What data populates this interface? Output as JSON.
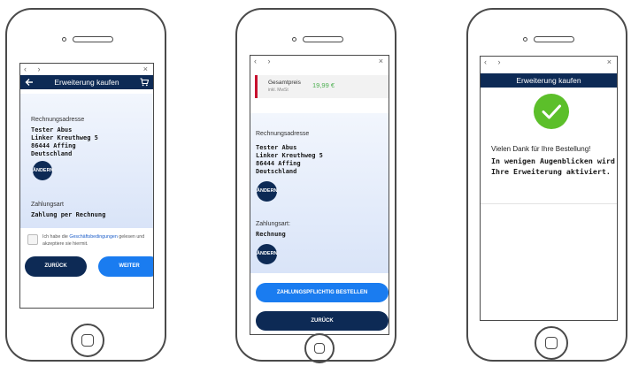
{
  "screen1": {
    "browser": {
      "nav": "‹ ›",
      "close": "×"
    },
    "header": {
      "back_icon": "arrow-left",
      "title": "Erweiterung kaufen",
      "cart_icon": "cart"
    },
    "billing": {
      "label": "Rechnungsadresse",
      "name": "Tester Abus",
      "street": "Linker Kreuthweg 5",
      "city": "86444 Affing",
      "country": "Deutschland",
      "change_button": "ÄNDERN"
    },
    "payment": {
      "label": "Zahlungsart",
      "value": "Zahlung per Rechnung"
    },
    "terms": {
      "checked": false,
      "text_before": "Ich habe die ",
      "link": "Geschäftsbedingungen",
      "text_after": " gelesen und akzeptiere sie hiermit."
    },
    "buttons": {
      "back": "ZURÜCK",
      "next": "WEITER"
    }
  },
  "screen2": {
    "browser": {
      "nav": "‹ ›",
      "close": "×"
    },
    "summary": {
      "label": "Gesamtpreis",
      "sublabel": "inkl. MwSt",
      "price": "19,99 €",
      "accent_color": "#c8102e",
      "price_color": "#4caf50"
    },
    "billing": {
      "label": "Rechnungsadresse",
      "name": "Tester Abus",
      "street": "Linker Kreuthweg 5",
      "city": "86444 Affing",
      "country": "Deutschland",
      "change_button": "ÄNDERN"
    },
    "payment": {
      "label": "Zahlungsart:",
      "value": "Rechnung",
      "change_button": "ÄNDERN"
    },
    "buttons": {
      "order": "ZAHLUNGSPFLICHTIG BESTELLEN",
      "back": "ZURÜCK"
    }
  },
  "screen3": {
    "browser": {
      "nav": "‹ ›",
      "close": "×"
    },
    "header": {
      "title": "Erweiterung kaufen"
    },
    "success_icon": "check-circle",
    "success_color": "#5cbf2a",
    "thanks": "Vielen Dank für Ihre Bestellung!",
    "message": "In wenigen Augenblicken wird Ihre Erweiterung aktiviert."
  }
}
